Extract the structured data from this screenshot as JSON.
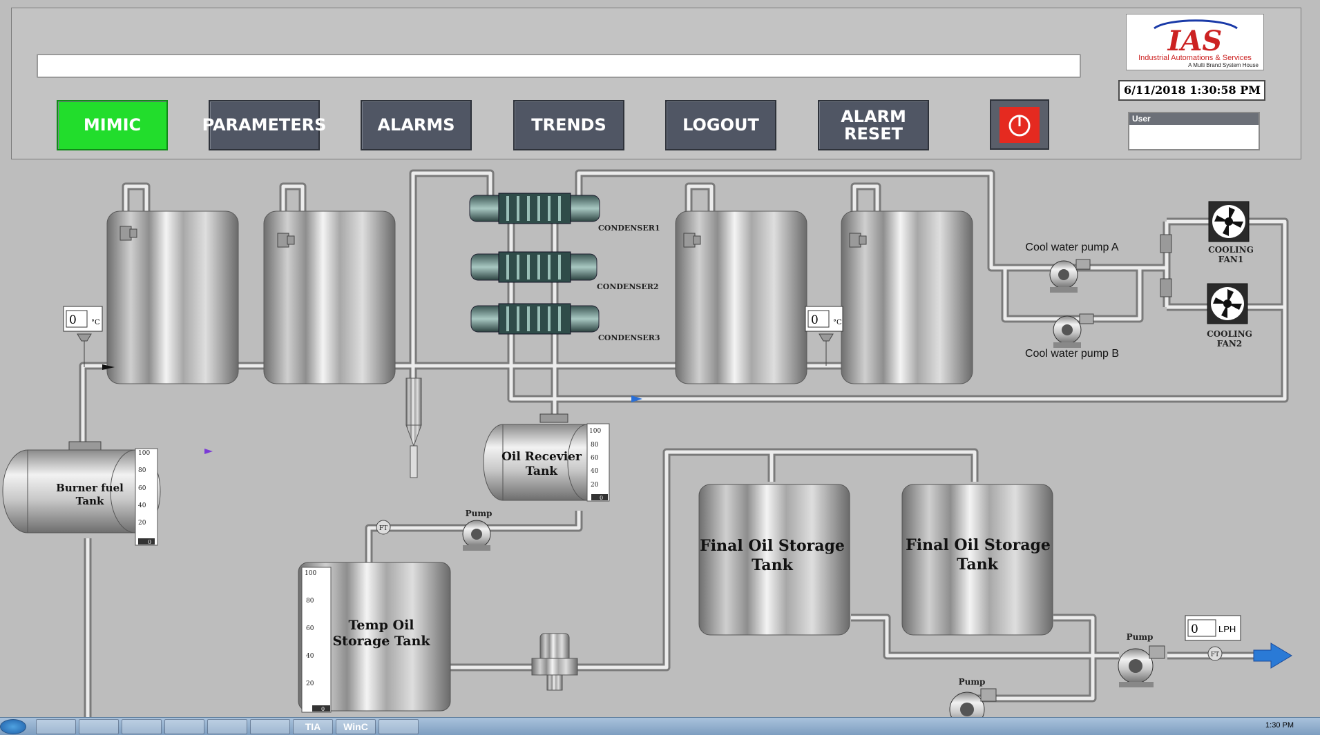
{
  "header": {
    "nav_buttons": [
      "MIMIC",
      "PARAMETERS",
      "ALARMS",
      "TRENDS",
      "LOGOUT",
      "ALARM",
      "RESET"
    ],
    "logo": {
      "brand": "IAS",
      "name": "Industrial Automations & Services",
      "tagline": "A Multi Brand System House"
    },
    "datetime": "6/11/2018 1:30:58 PM",
    "user_label": "User",
    "user_value": "",
    "message": ""
  },
  "colors": {
    "active_button": "#22dd2c",
    "button": "#505664",
    "power_button": "#e52a20",
    "background": "#bdbdbd",
    "flow_arrow": "#2a6fd6"
  },
  "mimic": {
    "condensers": [
      "CONDENSER1",
      "CONDENSER2",
      "CONDENSER3"
    ],
    "pumps": {
      "cool_water_a": "Cool water pump A",
      "cool_water_b": "Cool water pump B",
      "generic": "Pump"
    },
    "fans": [
      "COOLING",
      "FAN1",
      "COOLING",
      "FAN2"
    ],
    "tanks": {
      "burner_fuel": [
        "Burner fuel",
        "Tank"
      ],
      "oil_receiver": [
        "Oil Recevier",
        "Tank"
      ],
      "temp_oil_storage": [
        "Temp Oil",
        "Storage Tank"
      ],
      "final_oil_storage_1": [
        "Final Oil Storage",
        "Tank"
      ],
      "final_oil_storage_2": [
        "Final Oil Storage",
        "Tank"
      ]
    },
    "gauge_scale": [
      "100",
      "80",
      "60",
      "40",
      "20",
      "0"
    ],
    "temperature_displays": [
      {
        "value": "0",
        "unit": "°C"
      },
      {
        "value": "0",
        "unit": "°C"
      }
    ],
    "flow_display": {
      "value": "0",
      "unit": "LPH"
    },
    "flow_transmitter": "FT",
    "level_readouts": {
      "burner_fuel": "0",
      "oil_receiver": "0",
      "temp_oil_storage": "0"
    }
  },
  "taskbar": {
    "apps": [
      "",
      "",
      "",
      "",
      "",
      "",
      "",
      "TIA",
      "WinC",
      ""
    ],
    "time": "1:30 PM"
  }
}
